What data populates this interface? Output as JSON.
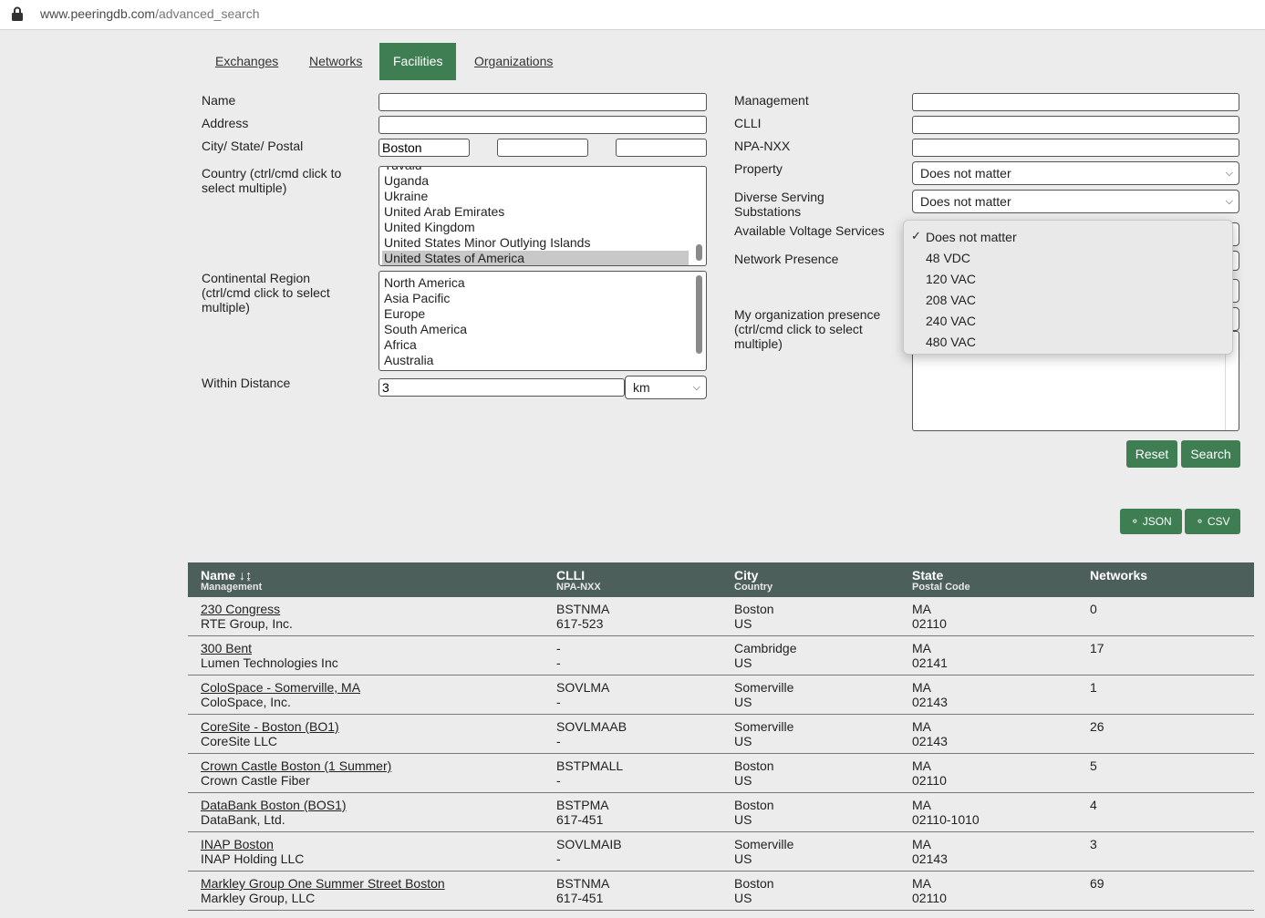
{
  "browser": {
    "url_domain": "www.peeringdb.com",
    "url_path": "/advanced_search"
  },
  "tabs": [
    "Exchanges",
    "Networks",
    "Facilities",
    "Organizations"
  ],
  "form_left": {
    "name_label": "Name",
    "address_label": "Address",
    "city_label": "City/ State/ Postal",
    "city_value": "Boston",
    "country_label": "Country (ctrl/cmd click to select multiple)",
    "countries": [
      "Tuvalu",
      "Uganda",
      "Ukraine",
      "United Arab Emirates",
      "United Kingdom",
      "United States Minor Outlying Islands",
      "United States of America"
    ],
    "country_selected": "United States of America",
    "region_label": "Continental Region (ctrl/cmd click to select multiple)",
    "regions": [
      "North America",
      "Asia Pacific",
      "Europe",
      "South America",
      "Africa",
      "Australia"
    ],
    "distance_label": "Within Distance",
    "distance_value": "3",
    "distance_unit": "km"
  },
  "form_right": {
    "management_label": "Management",
    "clli_label": "CLLI",
    "npanxx_label": "NPA-NXX",
    "property_label": "Property",
    "property_value": "Does not matter",
    "diverse_label": "Diverse Serving Substations",
    "diverse_value": "Does not matter",
    "voltage_label": "Available Voltage Services",
    "network_presence_label": "Network Presence",
    "my_org_label": "My organization presence (ctrl/cmd click to select multiple)"
  },
  "voltage_dropdown": {
    "options": [
      "Does not matter",
      "48 VDC",
      "120 VAC",
      "208 VAC",
      "240 VAC",
      "480 VAC"
    ],
    "selected": "Does not matter"
  },
  "buttons": {
    "reset": "Reset",
    "search": "Search",
    "json": "JSON",
    "csv": "CSV"
  },
  "table": {
    "headers": [
      {
        "main": "Name",
        "sub": "Management"
      },
      {
        "main": "CLLI",
        "sub": "NPA-NXX"
      },
      {
        "main": "City",
        "sub": "Country"
      },
      {
        "main": "State",
        "sub": "Postal Code"
      },
      {
        "main": "Networks",
        "sub": ""
      }
    ],
    "rows": [
      {
        "name": "230 Congress",
        "mgmt": "RTE Group, Inc.",
        "clli": "BSTNMA",
        "npa": "617-523",
        "city": "Boston",
        "country": "US",
        "state": "MA",
        "postal": "02110",
        "networks": "0"
      },
      {
        "name": "300 Bent",
        "mgmt": "Lumen Technologies Inc",
        "clli": "-",
        "npa": "-",
        "city": "Cambridge",
        "country": "US",
        "state": "MA",
        "postal": "02141",
        "networks": "17"
      },
      {
        "name": "ColoSpace - Somerville, MA",
        "mgmt": "ColoSpace, Inc.",
        "clli": "SOVLMA",
        "npa": "-",
        "city": "Somerville",
        "country": "US",
        "state": "MA",
        "postal": "02143",
        "networks": "1"
      },
      {
        "name": "CoreSite - Boston (BO1)",
        "mgmt": "CoreSite LLC",
        "clli": "SOVLMAAB",
        "npa": "-",
        "city": "Somerville",
        "country": "US",
        "state": "MA",
        "postal": "02143",
        "networks": "26"
      },
      {
        "name": "Crown Castle Boston (1 Summer)",
        "mgmt": "Crown Castle Fiber",
        "clli": "BSTPMALL",
        "npa": "-",
        "city": "Boston",
        "country": "US",
        "state": "MA",
        "postal": "02110",
        "networks": "5"
      },
      {
        "name": "DataBank Boston (BOS1)",
        "mgmt": "DataBank, Ltd.",
        "clli": "BSTPMA",
        "npa": "617-451",
        "city": "Boston",
        "country": "US",
        "state": "MA",
        "postal": "02110-1010",
        "networks": "4"
      },
      {
        "name": "INAP Boston",
        "mgmt": "INAP Holding LLC",
        "clli": "SOVLMAIB",
        "npa": "-",
        "city": "Somerville",
        "country": "US",
        "state": "MA",
        "postal": "02143",
        "networks": "3"
      },
      {
        "name": "Markley Group One Summer Street Boston",
        "mgmt": "Markley Group, LLC",
        "clli": "BSTNMA",
        "npa": "617-451",
        "city": "Boston",
        "country": "US",
        "state": "MA",
        "postal": "02110",
        "networks": "69"
      }
    ]
  },
  "colors": {
    "accent": "#3f7d53",
    "table_header": "#4c5f5a",
    "link": "#2d5d3c"
  }
}
